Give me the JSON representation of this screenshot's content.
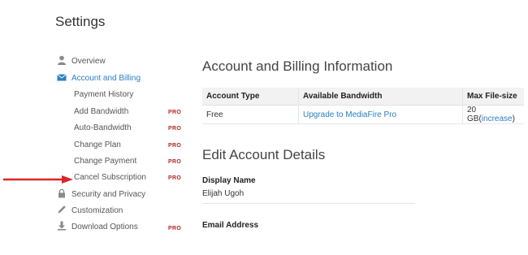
{
  "page": {
    "title": "Settings"
  },
  "sidebar": {
    "items": [
      {
        "label": "Overview",
        "icon": "user-icon"
      },
      {
        "label": "Account and Billing",
        "icon": "envelope-icon",
        "active": true
      },
      {
        "label": "Payment History"
      },
      {
        "label": "Add Bandwidth",
        "badge": "PRO"
      },
      {
        "label": "Auto-Bandwidth",
        "badge": "PRO"
      },
      {
        "label": "Change Plan",
        "badge": "PRO"
      },
      {
        "label": "Change Payment",
        "badge": "PRO"
      },
      {
        "label": "Cancel Subscription",
        "badge": "PRO"
      },
      {
        "label": "Security and Privacy",
        "icon": "lock-icon"
      },
      {
        "label": "Customization",
        "icon": "pencil-icon"
      },
      {
        "label": "Download Options",
        "icon": "download-icon",
        "badge": "PRO"
      }
    ]
  },
  "billing": {
    "heading": "Account and Billing Information",
    "columns": [
      "Account Type",
      "Available Bandwidth",
      "Max File-size"
    ],
    "row": {
      "account_type": "Free",
      "bandwidth_link": "Upgrade to MediaFire Pro",
      "filesize": "20 GB",
      "increase_link": "increase"
    }
  },
  "edit": {
    "heading": "Edit Account Details",
    "display_name_label": "Display Name",
    "display_name_value": "Elijah Ugoh",
    "email_label": "Email Address"
  },
  "colors": {
    "accent": "#2b7fc3",
    "pro_badge": "#b02a2a",
    "arrow": "#d9262b"
  }
}
